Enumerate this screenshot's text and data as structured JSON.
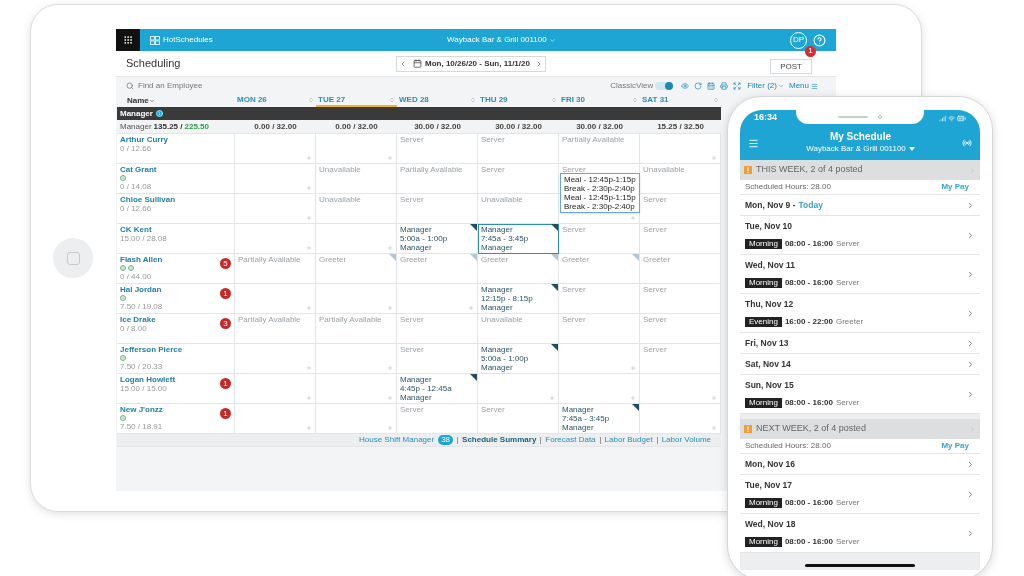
{
  "tablet": {
    "top_bar": {
      "logo": "HotSchedules",
      "location": "Wayback Bar & Grill 001100",
      "user_initials": "DP"
    },
    "page_title": "Scheduling",
    "date_range": "Mon, 10/26/20 - Sun, 11/1/20",
    "post_button": "POST",
    "post_badge": "1",
    "search": {
      "placeholder": "Find an Employee"
    },
    "classic_view": {
      "label": "ClassicView",
      "on": true
    },
    "filter": "Filter (2)",
    "menu": "Menu",
    "name_column": "Name",
    "days": [
      {
        "label": "MON 26",
        "selected": false
      },
      {
        "label": "TUE 27",
        "selected": true
      },
      {
        "label": "WED 28",
        "selected": false
      },
      {
        "label": "THU 29",
        "selected": false
      },
      {
        "label": "FRI 30",
        "selected": false
      },
      {
        "label": "SAT 31",
        "selected": false
      }
    ],
    "group": "Manager",
    "totals": {
      "label": "Manager",
      "hours": "135.25 /",
      "target": "225.50",
      "days": [
        "0.00 / 32.00",
        "0.00 / 32.00",
        "30.00 / 32.00",
        "30.00 / 32.00",
        "30.00 / 32.00",
        "15.25 / 32.50"
      ]
    },
    "employees": [
      {
        "name": "Arthur Curry",
        "hours": "0 / 12.66",
        "cells": [
          {
            "kind": "blank",
            "selected": false
          },
          {
            "kind": "blank",
            "selected": false
          },
          {
            "kind": "faded",
            "lines": [
              "Server"
            ],
            "selected": false
          },
          {
            "kind": "faded",
            "lines": [
              "Server"
            ],
            "selected": false
          },
          {
            "kind": "faded",
            "lines": [
              "Partially Available"
            ],
            "selected": false
          },
          {
            "kind": "blank",
            "selected": false
          }
        ]
      },
      {
        "name": "Cat Grant",
        "hours": "0 / 14.08",
        "tags": [
          {
            "kind": "role"
          }
        ],
        "cells": [
          {
            "kind": "blank",
            "selected": false
          },
          {
            "kind": "faded",
            "lines": [
              "Unavailable"
            ],
            "selected": false
          },
          {
            "kind": "faded",
            "lines": [
              "Partially Available"
            ],
            "selected": false
          },
          {
            "kind": "faded",
            "lines": [
              "Server"
            ],
            "selected": false
          },
          {
            "kind": "faded",
            "lines": [
              "Server"
            ],
            "selected": false
          },
          {
            "kind": "faded",
            "lines": [
              "Unavailable"
            ],
            "selected": false
          }
        ]
      },
      {
        "name": "Chloe Sullivan",
        "hours": "0 / 12.66",
        "cells": [
          {
            "kind": "blank",
            "selected": false
          },
          {
            "kind": "faded",
            "lines": [
              "Unavailable"
            ],
            "selected": false
          },
          {
            "kind": "faded",
            "lines": [
              "Server"
            ],
            "selected": false
          },
          {
            "kind": "faded",
            "lines": [
              "Unavailable"
            ],
            "selected": false
          },
          {
            "kind": "blank",
            "selected": false
          },
          {
            "kind": "faded",
            "lines": [
              "Server"
            ],
            "selected": false
          }
        ]
      },
      {
        "name": "CK Kent",
        "hours": "15.00 / 28.08",
        "cells": [
          {
            "kind": "blank",
            "selected": false
          },
          {
            "kind": "blank",
            "selected": false
          },
          {
            "kind": "shift",
            "lines": [
              "Manager",
              "5:00a - 1:00p",
              "Manager"
            ],
            "color": "#1f4e63",
            "selected": false
          },
          {
            "kind": "shift",
            "lines": [
              "Manager",
              "7:45a - 3:45p",
              "Manager"
            ],
            "color": "#1f4e63",
            "selected": true
          },
          {
            "kind": "faded",
            "lines": [
              "Server"
            ],
            "selected": false
          },
          {
            "kind": "faded",
            "lines": [
              "Server"
            ],
            "selected": false
          }
        ]
      },
      {
        "name": "Flash Allen",
        "hours": "0 / 44.00",
        "alert": "5",
        "tags": [
          {
            "kind": "role"
          },
          {
            "kind": "role"
          }
        ],
        "cells": [
          {
            "kind": "faded",
            "lines": [
              "Partially Available"
            ],
            "selected": false
          },
          {
            "kind": "faded",
            "lines": [
              "Greeter"
            ],
            "color": "#b5c7d3",
            "selected": false
          },
          {
            "kind": "faded",
            "lines": [
              "Greeter"
            ],
            "color": "#b5c7d3",
            "selected": false
          },
          {
            "kind": "faded",
            "lines": [
              "Greeter"
            ],
            "color": "#b5c7d3",
            "selected": false
          },
          {
            "kind": "faded",
            "lines": [
              "Greeter"
            ],
            "color": "#b5c7d3",
            "selected": false
          },
          {
            "kind": "faded",
            "lines": [
              "Greeter"
            ],
            "selected": false
          }
        ]
      },
      {
        "name": "Hal Jordan",
        "hours": "7.50 / 19.08",
        "alert": "1",
        "tags": [
          {
            "kind": "role"
          }
        ],
        "cells": [
          {
            "kind": "blank",
            "selected": false
          },
          {
            "kind": "blank",
            "selected": false
          },
          {
            "kind": "blank",
            "selected": false
          },
          {
            "kind": "shift",
            "lines": [
              "Manager",
              "12:15p - 8:15p",
              "Manager"
            ],
            "color": "#1f4e63",
            "selected": false
          },
          {
            "kind": "faded",
            "lines": [
              "Server"
            ],
            "selected": false
          },
          {
            "kind": "faded",
            "lines": [
              "Server"
            ],
            "selected": false
          }
        ]
      },
      {
        "name": "Ice Drake",
        "hours": "0 / 8.00",
        "alert": "3",
        "cells": [
          {
            "kind": "faded",
            "lines": [
              "Partially Available"
            ],
            "selected": false
          },
          {
            "kind": "faded",
            "lines": [
              "Partially Available"
            ],
            "selected": false
          },
          {
            "kind": "faded",
            "lines": [
              "Server"
            ],
            "selected": false
          },
          {
            "kind": "faded",
            "lines": [
              "Unavailable"
            ],
            "selected": false
          },
          {
            "kind": "faded",
            "lines": [
              "Server"
            ],
            "selected": false
          },
          {
            "kind": "faded",
            "lines": [
              "Server"
            ],
            "selected": false
          }
        ]
      },
      {
        "name": "Jefferson Pierce",
        "hours": "7.50 / 20.33",
        "tags": [
          {
            "kind": "role"
          }
        ],
        "cells": [
          {
            "kind": "blank",
            "selected": false
          },
          {
            "kind": "blank",
            "selected": false
          },
          {
            "kind": "faded",
            "lines": [
              "Server"
            ],
            "selected": false
          },
          {
            "kind": "shift",
            "lines": [
              "Manager",
              "5:00a - 1:00p",
              "Manager"
            ],
            "color": "#1f4e63",
            "selected": false
          },
          {
            "kind": "blank",
            "selected": false
          },
          {
            "kind": "faded",
            "lines": [
              "Server"
            ],
            "selected": false
          }
        ]
      },
      {
        "name": "Logan Howlett",
        "hours": "15.00 / 15.00",
        "alert": "1",
        "cells": [
          {
            "kind": "blank",
            "selected": false
          },
          {
            "kind": "blank",
            "selected": false
          },
          {
            "kind": "shift",
            "lines": [
              "Manager",
              "4:45p - 12:45a",
              "Manager"
            ],
            "color": "#1f4e63",
            "selected": false
          },
          {
            "kind": "blank",
            "selected": false
          },
          {
            "kind": "blank",
            "selected": false
          },
          {
            "kind": "blank",
            "selected": false
          }
        ]
      },
      {
        "name": "New J'onzz",
        "hours": "7.50 / 18.91",
        "alert": "1",
        "tags": [
          {
            "kind": "role"
          }
        ],
        "cells": [
          {
            "kind": "blank",
            "selected": false
          },
          {
            "kind": "blank",
            "selected": false
          },
          {
            "kind": "faded",
            "lines": [
              "Server"
            ],
            "selected": false
          },
          {
            "kind": "faded",
            "lines": [
              "Server"
            ],
            "selected": false
          },
          {
            "kind": "shift",
            "lines": [
              "Manager",
              "7:45a - 3:45p",
              "Manager"
            ],
            "color": "#1f4e63",
            "selected": false
          },
          {
            "kind": "blank",
            "selected": false
          }
        ]
      }
    ],
    "tooltip": [
      "Meal - 12:45p-1:15p",
      "Break - 2:30p-2:40p",
      "Meal - 12:45p-1:15p",
      "Break - 2:30p-2:40p"
    ],
    "footer": [
      {
        "label": "House Shift Manager",
        "badge": "38",
        "selected": false
      },
      {
        "label": "Schedule Summary",
        "selected": true
      },
      {
        "label": "Forecast Data",
        "selected": false
      },
      {
        "label": "Labor Budget",
        "selected": false
      },
      {
        "label": "Labor Volume",
        "selected": false
      }
    ]
  },
  "phone": {
    "time": "16:34",
    "title": "My Schedule",
    "location": "Wayback Bar & Grill 001100",
    "weeks": [
      {
        "title": "THIS WEEK, 2 of 4 posted",
        "hours": "Scheduled Hours: 28.00",
        "pay": "My Pay",
        "days": [
          {
            "date": "Mon, Nov 9 -",
            "today": "Today"
          },
          {
            "date": "Tue, Nov 10",
            "shift": {
              "period": "Morning",
              "time": "08:00 - 16:00",
              "role": "Server"
            }
          },
          {
            "date": "Wed, Nov 11",
            "shift": {
              "period": "Morning",
              "time": "08:00 - 16:00",
              "role": "Server"
            }
          },
          {
            "date": "Thu, Nov 12",
            "shift": {
              "period": "Evening",
              "time": "16:00 - 22:00",
              "role": "Greeter"
            }
          },
          {
            "date": "Fri, Nov 13"
          },
          {
            "date": "Sat, Nov 14"
          },
          {
            "date": "Sun, Nov 15",
            "shift": {
              "period": "Morning",
              "time": "08:00 - 16:00",
              "role": "Server"
            }
          }
        ]
      },
      {
        "title": "NEXT WEEK, 2 of 4 posted",
        "hours": "Scheduled Hours: 28.00",
        "pay": "My Pay",
        "days": [
          {
            "date": "Mon, Nov 16"
          },
          {
            "date": "Tue, Nov 17",
            "shift": {
              "period": "Morning",
              "time": "08:00 - 16:00",
              "role": "Server"
            }
          },
          {
            "date": "Wed, Nov 18",
            "shift": {
              "period": "Morning",
              "time": "08:00 - 16:00",
              "role": "Server"
            }
          }
        ]
      }
    ]
  }
}
